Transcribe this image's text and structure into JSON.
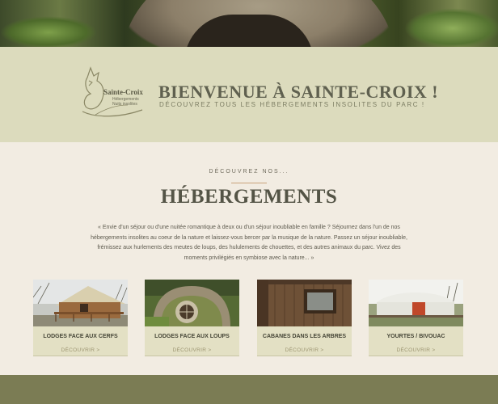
{
  "welcome": {
    "logo": {
      "name": "Sainte-Croix",
      "line1": "Hébergements",
      "line2": "Nuits insolites"
    },
    "title": "BIENVENUE À SAINTE-CROIX !",
    "subtitle": "DÉCOUVREZ TOUS LES HÉBERGEMENTS INSOLITES DU PARC !"
  },
  "section": {
    "kicker": "DÉCOUVREZ NOS...",
    "title": "HÉBERGEMENTS",
    "intro": "« Envie d'un séjour ou d'une nuitée romantique à deux ou d'un séjour inoubliable en famille ? Séjournez dans l'un de nos hébergements insolites au coeur de la nature et laissez-vous bercer par la musique de la nature. Passez un séjour inoubliable, frémissez aux hurlements des meutes de loups, des hululements de chouettes, et des autres animaux du parc. Vivez des moments privilégiés en symbiose avec la nature... »"
  },
  "cards": [
    {
      "name": "LODGES FACE AUX CERFS",
      "more": "DÉCOUVRIR >"
    },
    {
      "name": "LODGES FACE AUX LOUPS",
      "more": "DÉCOUVRIR >"
    },
    {
      "name": "CABANES DANS LES ARBRES",
      "more": "DÉCOUVRIR >"
    },
    {
      "name": "YOURTES / BIVOUAC",
      "more": "DÉCOUVRIR >"
    }
  ],
  "colors": {
    "accent": "#c9a27a",
    "band": "#dcdbbd",
    "footer": "#7b7c54",
    "title": "#545446"
  }
}
